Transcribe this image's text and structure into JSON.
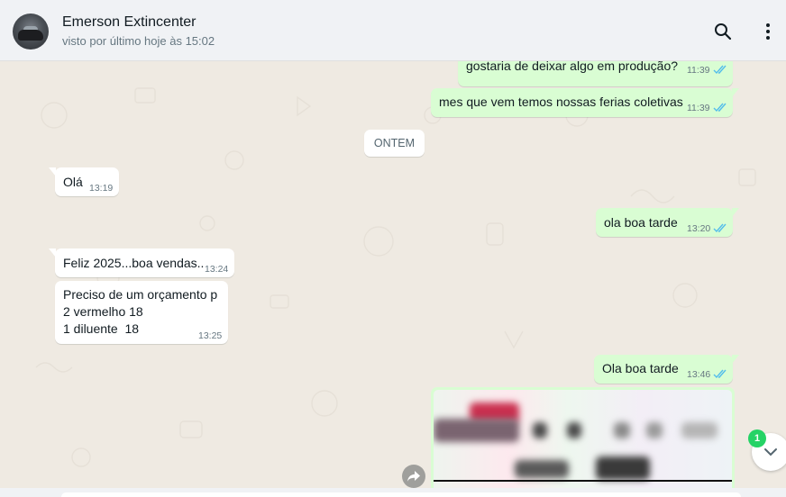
{
  "header": {
    "contact_name": "Emerson Extincenter",
    "status": "visto por último hoje às 15:02",
    "icons": [
      "search-icon",
      "menu-dots-icon"
    ]
  },
  "date_separator": "ONTEM",
  "messages": [
    {
      "direction": "out",
      "text": "gostaria de deixar algo em produção?",
      "time": "11:39",
      "status": "read"
    },
    {
      "direction": "out",
      "text": "mes que vem temos nossas ferias coletivas",
      "time": "11:39",
      "status": "read"
    },
    {
      "direction": "in",
      "text": "Olá",
      "time": "13:19"
    },
    {
      "direction": "out",
      "text": "ola boa tarde",
      "time": "13:20",
      "status": "read"
    },
    {
      "direction": "in",
      "text": "Feliz 2025...boa vendas..",
      "time": "13:24"
    },
    {
      "direction": "in",
      "lines": [
        "Preciso de um orçamento p",
        "2 vermelho 18",
        "1 diluente  18"
      ],
      "time": "13:25"
    },
    {
      "direction": "out",
      "text": "Ola boa tarde",
      "time": "13:46",
      "status": "read"
    }
  ],
  "unread_count": "1",
  "colors": {
    "chat_background": "#efeae2",
    "outgoing_bubble": "#d9fdd3",
    "incoming_bubble": "#ffffff",
    "read_ticks": "#53bdeb",
    "unread_badge": "#25d366",
    "header_background": "#f0f2f5"
  }
}
